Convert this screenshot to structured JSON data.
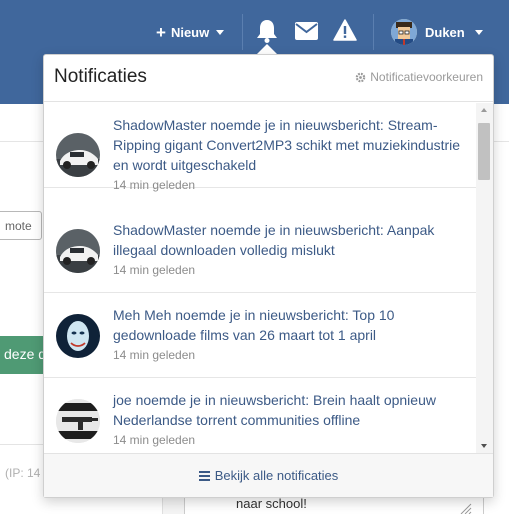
{
  "navbar": {
    "new_label": "Nieuw",
    "user_name": "Duken",
    "icons": [
      "bell-icon",
      "envelope-icon",
      "warning-icon"
    ],
    "color": "#40679c"
  },
  "background": {
    "mote_label": "mote",
    "green_button_label": "deze d",
    "ip_text": "(IP: 14",
    "textarea_text": "naar school!"
  },
  "notifications": {
    "title": "Notificaties",
    "preferences_label": "Notificatievoorkeuren",
    "items": [
      {
        "user": "ShadowMaster",
        "text": "ShadowMaster noemde je in nieuwsbericht: Stream-Ripping gigant Convert2MP3 schikt met muziekindustrie en wordt uitgeschakeld",
        "time": "14 min geleden",
        "avatar": "car-avatar"
      },
      {
        "user": "ShadowMaster",
        "text": "ShadowMaster noemde je in nieuwsbericht: Aanpak illegaal downloaden volledig mislukt",
        "time": "14 min geleden",
        "avatar": "car-avatar"
      },
      {
        "user": "Meh Meh",
        "text": "Meh Meh noemde je in nieuwsbericht: Top 10 gedownloade films van 26 maart tot 1 april",
        "time": "14 min geleden",
        "avatar": "mask-avatar"
      },
      {
        "user": "joe",
        "text": "joe noemde je in nieuwsbericht: Brein haalt opnieuw Nederlandse torrent communities offline",
        "time": "14 min geleden",
        "avatar": "gun-avatar"
      }
    ],
    "footer_label": "Bekijk alle notificaties",
    "link_color": "#3c5a86"
  }
}
